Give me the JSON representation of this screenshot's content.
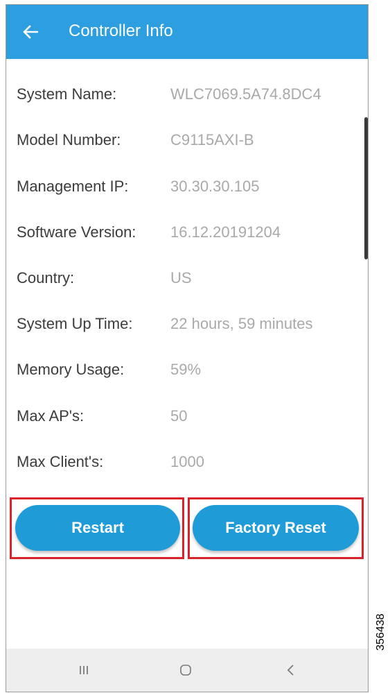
{
  "header": {
    "title": "Controller Info"
  },
  "info_rows": [
    {
      "label": "System Name:",
      "value": "WLC7069.5A74.8DC4"
    },
    {
      "label": "Model Number:",
      "value": "C9115AXI-B"
    },
    {
      "label": "Management IP:",
      "value": "30.30.30.105"
    },
    {
      "label": "Software Version:",
      "value": "16.12.20191204"
    },
    {
      "label": "Country:",
      "value": "US"
    },
    {
      "label": "System Up Time:",
      "value": "22 hours, 59 minutes"
    },
    {
      "label": "Memory Usage:",
      "value": "59%"
    },
    {
      "label": "Max AP's:",
      "value": "50"
    },
    {
      "label": "Max Client's:",
      "value": "1000"
    }
  ],
  "actions": {
    "restart_label": "Restart",
    "factory_reset_label": "Factory Reset"
  },
  "figure_id": "356438",
  "colors": {
    "appbar": "#2d9fe0",
    "button": "#1f9bd8",
    "highlight": "#d8232a"
  },
  "icons": {
    "back": "arrow-left-icon",
    "recents": "recents-icon",
    "home": "home-icon",
    "nav_back": "chevron-left-icon"
  }
}
